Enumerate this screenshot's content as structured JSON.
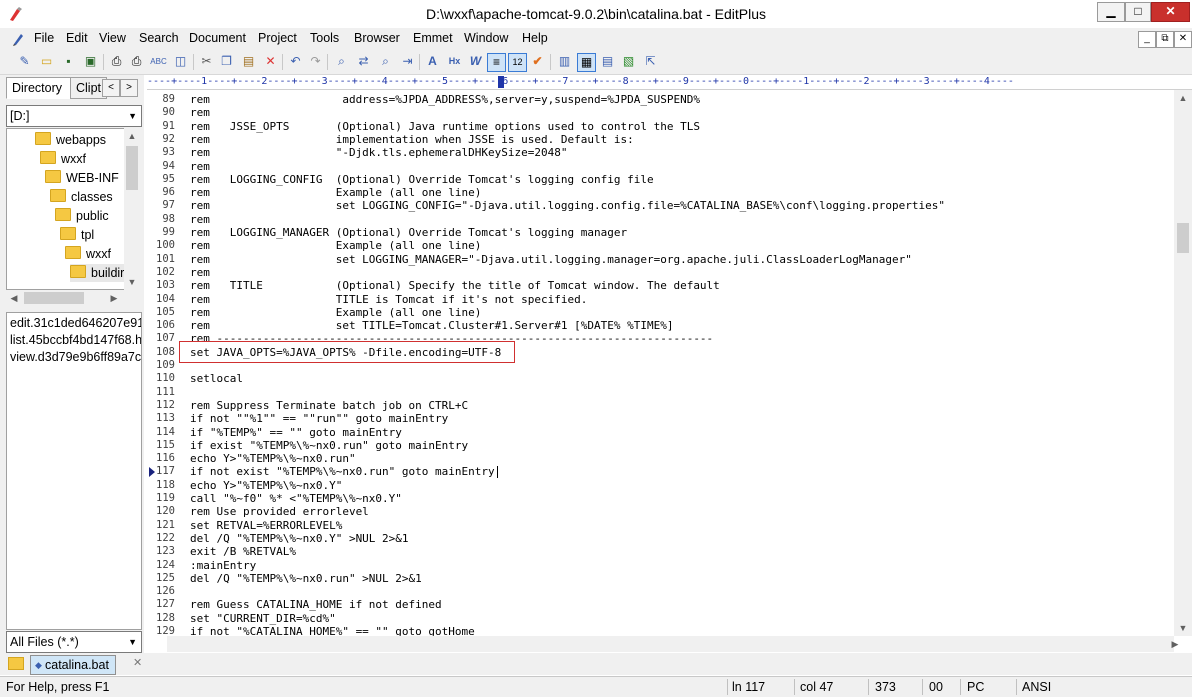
{
  "window": {
    "title": "D:\\wxxf\\apache-tomcat-9.0.2\\bin\\catalina.bat - EditPlus",
    "minimize": "▁",
    "maximize": "□",
    "close": "✕"
  },
  "menu": [
    "File",
    "Edit",
    "View",
    "Search",
    "Document",
    "Project",
    "Tools",
    "Browser",
    "Emmet",
    "Window",
    "Help"
  ],
  "mdi_buttons": [
    "_",
    "⧉",
    "✕"
  ],
  "left_panel": {
    "tabs": [
      "Directory",
      "Clipt"
    ],
    "arrows": [
      "<",
      ">"
    ],
    "drive": "[D:]",
    "tree": [
      "webapps",
      "wxxf",
      "WEB-INF",
      "classes",
      "public",
      "tpl",
      "wxxf",
      "buildir"
    ],
    "files": [
      "edit.31c1ded646207e91",
      "list.45bccbf4bd147f68.h",
      "view.d3d79e9b6ff89a7c"
    ],
    "filter": "All Files (*.*)"
  },
  "ruler": "----+----1----+----2----+----3----+----4----+----5----+----6----+----7----+----8----+----9----+----0----+----1----+----2----+----3----+----4----",
  "editor": {
    "lines": [
      {
        "n": "89",
        "t": "rem                    address=%JPDA_ADDRESS%,server=y,suspend=%JPDA_SUSPEND%"
      },
      {
        "n": "90",
        "t": "rem"
      },
      {
        "n": "91",
        "t": "rem   JSSE_OPTS       (Optional) Java runtime options used to control the TLS"
      },
      {
        "n": "92",
        "t": "rem                   implementation when JSSE is used. Default is:"
      },
      {
        "n": "93",
        "t": "rem                   \"-Djdk.tls.ephemeralDHKeySize=2048\""
      },
      {
        "n": "94",
        "t": "rem"
      },
      {
        "n": "95",
        "t": "rem   LOGGING_CONFIG  (Optional) Override Tomcat's logging config file"
      },
      {
        "n": "96",
        "t": "rem                   Example (all one line)"
      },
      {
        "n": "97",
        "t": "rem                   set LOGGING_CONFIG=\"-Djava.util.logging.config.file=%CATALINA_BASE%\\conf\\logging.properties\""
      },
      {
        "n": "98",
        "t": "rem"
      },
      {
        "n": "99",
        "t": "rem   LOGGING_MANAGER (Optional) Override Tomcat's logging manager"
      },
      {
        "n": "100",
        "t": "rem                   Example (all one line)"
      },
      {
        "n": "101",
        "t": "rem                   set LOGGING_MANAGER=\"-Djava.util.logging.manager=org.apache.juli.ClassLoaderLogManager\""
      },
      {
        "n": "102",
        "t": "rem"
      },
      {
        "n": "103",
        "t": "rem   TITLE           (Optional) Specify the title of Tomcat window. The default"
      },
      {
        "n": "104",
        "t": "rem                   TITLE is Tomcat if it's not specified."
      },
      {
        "n": "105",
        "t": "rem                   Example (all one line)"
      },
      {
        "n": "106",
        "t": "rem                   set TITLE=Tomcat.Cluster#1.Server#1 [%DATE% %TIME%]"
      },
      {
        "n": "107",
        "t": "rem ---------------------------------------------------------------------------"
      },
      {
        "n": "108",
        "t": "set JAVA_OPTS=%JAVA_OPTS% -Dfile.encoding=UTF-8"
      },
      {
        "n": "109",
        "t": ""
      },
      {
        "n": "110",
        "t": "setlocal"
      },
      {
        "n": "111",
        "t": ""
      },
      {
        "n": "112",
        "t": "rem Suppress Terminate batch job on CTRL+C"
      },
      {
        "n": "113",
        "t": "if not \"\"%1\"\" == \"\"run\"\" goto mainEntry"
      },
      {
        "n": "114",
        "t": "if \"%TEMP%\" == \"\" goto mainEntry"
      },
      {
        "n": "115",
        "t": "if exist \"%TEMP%\\%~nx0.run\" goto mainEntry"
      },
      {
        "n": "116",
        "t": "echo Y>\"%TEMP%\\%~nx0.run\""
      },
      {
        "n": "117",
        "t": "if not exist \"%TEMP%\\%~nx0.run\" goto mainEntry"
      },
      {
        "n": "118",
        "t": "echo Y>\"%TEMP%\\%~nx0.Y\""
      },
      {
        "n": "119",
        "t": "call \"%~f0\" %* <\"%TEMP%\\%~nx0.Y\""
      },
      {
        "n": "120",
        "t": "rem Use provided errorlevel"
      },
      {
        "n": "121",
        "t": "set RETVAL=%ERRORLEVEL%"
      },
      {
        "n": "122",
        "t": "del /Q \"%TEMP%\\%~nx0.Y\" >NUL 2>&1"
      },
      {
        "n": "123",
        "t": "exit /B %RETVAL%"
      },
      {
        "n": "124",
        "t": ":mainEntry"
      },
      {
        "n": "125",
        "t": "del /Q \"%TEMP%\\%~nx0.run\" >NUL 2>&1"
      },
      {
        "n": "126",
        "t": ""
      },
      {
        "n": "127",
        "t": "rem Guess CATALINA_HOME if not defined"
      },
      {
        "n": "128",
        "t": "set \"CURRENT_DIR=%cd%\""
      },
      {
        "n": "129",
        "t": "if not \"%CATALINA_HOME%\" == \"\" goto gotHome"
      }
    ]
  },
  "file_tab": "catalina.bat",
  "status": {
    "help": "For Help, press F1",
    "line": "ln 117",
    "col": "col 47",
    "total": "373",
    "mode": "00",
    "eol": "PC",
    "encoding": "ANSI"
  }
}
